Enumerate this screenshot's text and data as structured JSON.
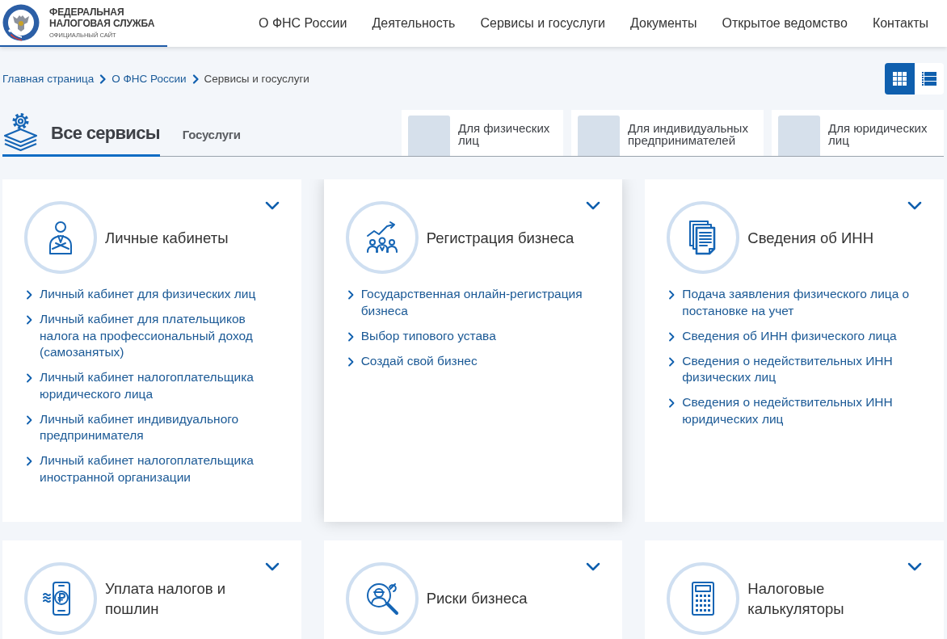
{
  "header": {
    "logo": {
      "title": "ФЕДЕРАЛЬНАЯ НАЛОГОВАЯ СЛУЖБА",
      "subtitle": "ОФИЦИАЛЬНЫЙ САЙТ"
    },
    "nav": [
      "О ФНС России",
      "Деятельность",
      "Сервисы и госуслуги",
      "Документы",
      "Открытое ведомство",
      "Контакты"
    ]
  },
  "breadcrumbs": [
    {
      "label": "Главная страница",
      "current": false
    },
    {
      "label": "О ФНС России",
      "current": false
    },
    {
      "label": "Сервисы и госуслуги",
      "current": true
    }
  ],
  "view_toggle": [
    {
      "selected": true
    },
    {
      "selected": false
    }
  ],
  "section_tabs": [
    {
      "label": "Все сервисы",
      "selected": true
    },
    {
      "label": "Госуслуги",
      "selected": false
    }
  ],
  "audience_tabs": [
    {
      "label": "Для физических лиц"
    },
    {
      "label": "Для индивидуальных предпринимателей"
    },
    {
      "label": "Для юридических лиц"
    }
  ],
  "cards": [
    {
      "title": "Личные кабинеты",
      "hovered": false,
      "links": [
        "Личный кабинет для физических лиц",
        "Личный кабинет для плательщиков налога на профессиональный доход (самозанятых)",
        "Личный кабинет налогоплательщика юридического лица",
        "Личный кабинет индивидуального предпринимателя",
        "Личный кабинет налогоплательщика иностранной организации"
      ]
    },
    {
      "title": "Регистрация бизнеса",
      "hovered": true,
      "links": [
        "Государственная онлайн-регистрация бизнеса",
        "Выбор типового устава",
        "Создай свой бизнес"
      ]
    },
    {
      "title": "Сведения об ИНН",
      "hovered": false,
      "links": [
        "Подача заявления физического лица о постановке на учет",
        "Сведения об ИНН физического лица",
        "Сведения о недействительных ИНН физических лиц",
        "Сведения о недействительных ИНН юридических лиц"
      ]
    },
    {
      "title": "Уплата налогов и пошлин",
      "hovered": false
    },
    {
      "title": "Риски бизнеса",
      "hovered": false
    },
    {
      "title": "Налоговые калькуляторы",
      "hovered": false
    }
  ]
}
